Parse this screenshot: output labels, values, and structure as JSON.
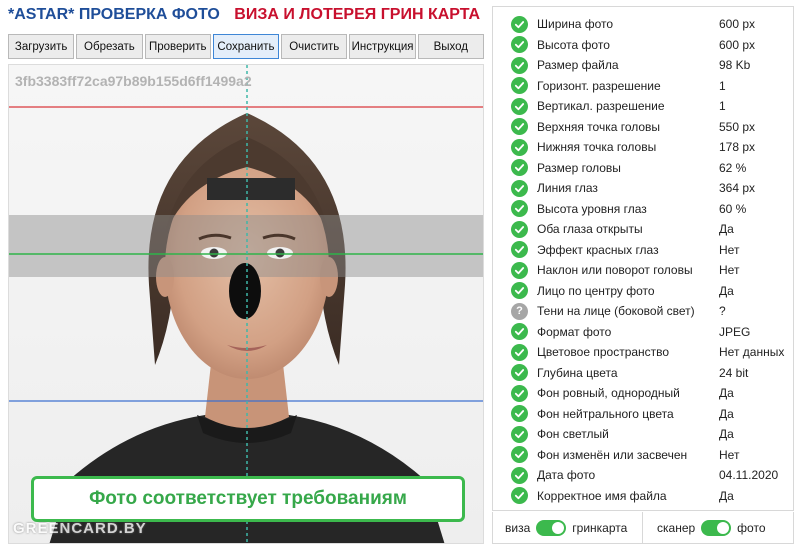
{
  "header": {
    "title_blue": "*ASTAR* ПРОВЕРКА ФОТО",
    "title_red": "ВИЗА И ЛОТЕРЕЯ ГРИН КАРТА"
  },
  "toolbar": {
    "buttons": [
      "Загрузить",
      "Обрезать",
      "Проверить",
      "Сохранить",
      "Очистить",
      "Инструкция",
      "Выход"
    ],
    "active": "Сохранить"
  },
  "photo": {
    "hash": "3fb3383ff72ca97b89b155d6ff1499a2",
    "result": "Фото соответствует требованиям",
    "watermark": "GREENCARD.BY"
  },
  "checks": [
    {
      "label": "Ширина фото",
      "value": "600 px",
      "status": "ok"
    },
    {
      "label": "Высота фото",
      "value": "600 px",
      "status": "ok"
    },
    {
      "label": "Размер файла",
      "value": "98 Kb",
      "status": "ok"
    },
    {
      "label": "Горизонт. разрешение",
      "value": "1",
      "status": "ok"
    },
    {
      "label": "Вертикал. разрешение",
      "value": "1",
      "status": "ok"
    },
    {
      "label": "Верхняя точка головы",
      "value": "550 px",
      "status": "ok"
    },
    {
      "label": "Нижняя точка головы",
      "value": "178 px",
      "status": "ok"
    },
    {
      "label": "Размер головы",
      "value": "62 %",
      "status": "ok"
    },
    {
      "label": "Линия глаз",
      "value": "364 px",
      "status": "ok"
    },
    {
      "label": "Высота уровня глаз",
      "value": "60 %",
      "status": "ok"
    },
    {
      "label": "Оба глаза открыты",
      "value": "Да",
      "status": "ok"
    },
    {
      "label": "Эффект красных глаз",
      "value": "Нет",
      "status": "ok"
    },
    {
      "label": "Наклон или поворот головы",
      "value": "Нет",
      "status": "ok"
    },
    {
      "label": "Лицо по центру фото",
      "value": "Да",
      "status": "ok"
    },
    {
      "label": "Тени на лице (боковой свет)",
      "value": "?",
      "status": "unknown"
    },
    {
      "label": "Формат фото",
      "value": "JPEG",
      "status": "ok"
    },
    {
      "label": "Цветовое пространство",
      "value": "Нет данных",
      "status": "ok"
    },
    {
      "label": "Глубина цвета",
      "value": "24 bit",
      "status": "ok"
    },
    {
      "label": "Фон ровный, однородный",
      "value": "Да",
      "status": "ok"
    },
    {
      "label": "Фон нейтрального цвета",
      "value": "Да",
      "status": "ok"
    },
    {
      "label": "Фон светлый",
      "value": "Да",
      "status": "ok"
    },
    {
      "label": "Фон изменён или засвечен",
      "value": "Нет",
      "status": "ok"
    },
    {
      "label": "Дата фото",
      "value": "04.11.2020",
      "status": "ok"
    },
    {
      "label": "Корректное имя файла",
      "value": "Да",
      "status": "ok"
    }
  ],
  "toggles": {
    "type_left": "виза",
    "type_right": "гринкарта",
    "type_on": true,
    "source_left": "сканер",
    "source_right": "фото",
    "source_on": true
  },
  "colors": {
    "ok": "#3cb94d",
    "unknown": "#a6a6a6",
    "title_blue": "#1f4e99",
    "title_red": "#c8102e"
  },
  "icons": {
    "ok": "check-circle-icon",
    "unknown": "question-circle-icon"
  }
}
